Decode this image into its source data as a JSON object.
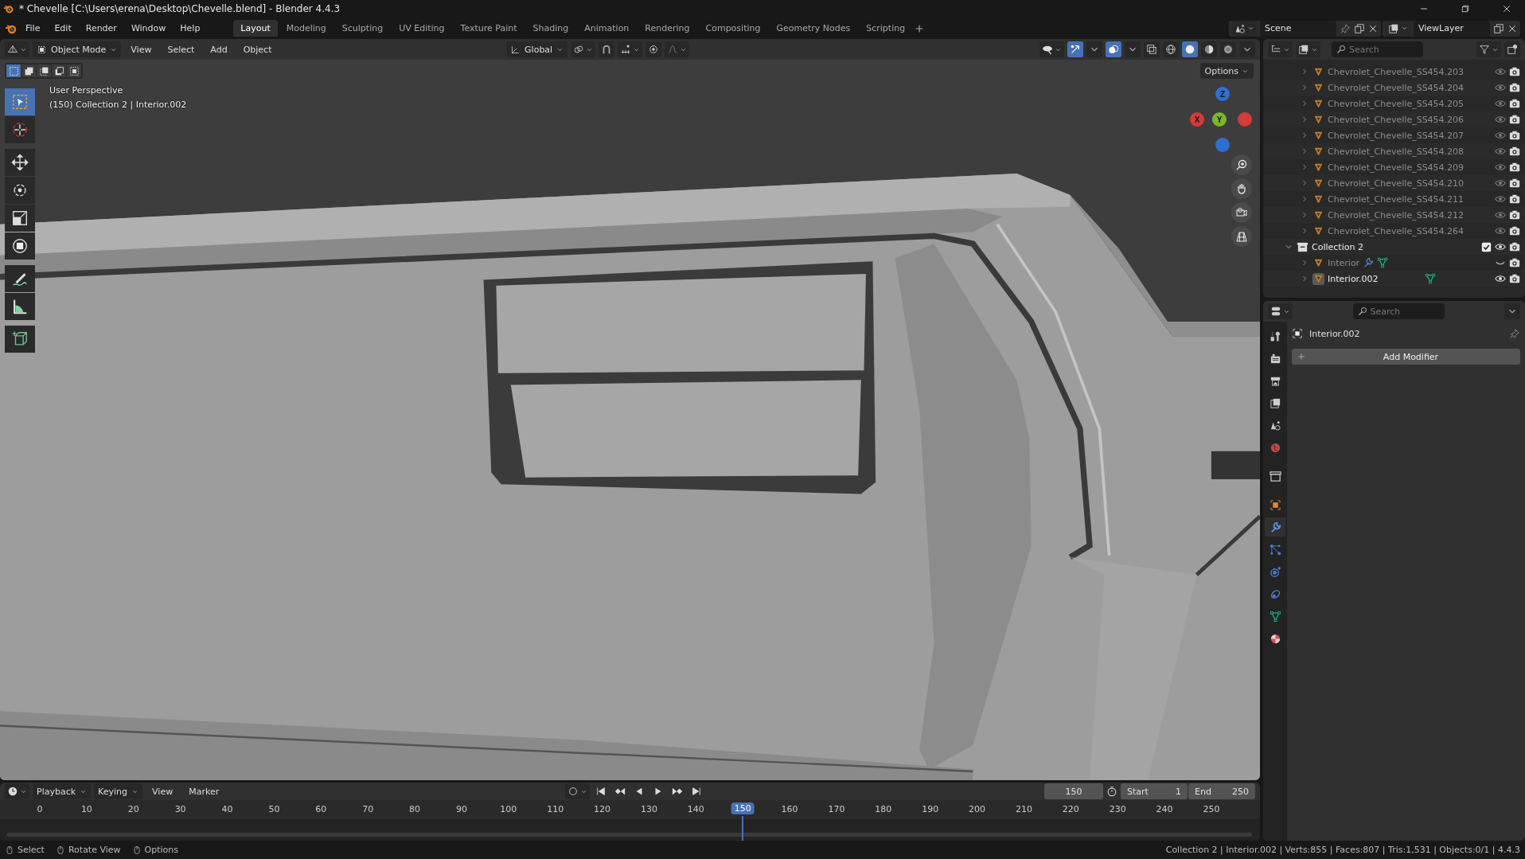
{
  "window": {
    "title": "* Chevelle [C:\\Users\\erena\\Desktop\\Chevelle.blend] - Blender 4.4.3"
  },
  "menu": [
    "File",
    "Edit",
    "Render",
    "Window",
    "Help"
  ],
  "workspaces": [
    {
      "label": "Layout",
      "selected": true
    },
    {
      "label": "Modeling",
      "selected": false
    },
    {
      "label": "Sculpting",
      "selected": false
    },
    {
      "label": "UV Editing",
      "selected": false
    },
    {
      "label": "Texture Paint",
      "selected": false
    },
    {
      "label": "Shading",
      "selected": false
    },
    {
      "label": "Animation",
      "selected": false
    },
    {
      "label": "Rendering",
      "selected": false
    },
    {
      "label": "Compositing",
      "selected": false
    },
    {
      "label": "Geometry Nodes",
      "selected": false
    },
    {
      "label": "Scripting",
      "selected": false
    }
  ],
  "scene": {
    "name": "Scene"
  },
  "view_layer": {
    "name": "ViewLayer"
  },
  "viewport_header": {
    "mode": "Object Mode",
    "menus": [
      "View",
      "Select",
      "Add",
      "Object"
    ],
    "orientation": "Global",
    "shading_modes": [
      {
        "kind": "wireframe",
        "selected": false
      },
      {
        "kind": "solid",
        "selected": true
      },
      {
        "kind": "material",
        "selected": false
      },
      {
        "kind": "rendered",
        "selected": false
      }
    ],
    "select_modes": [
      {
        "selected": true
      },
      {
        "selected": false
      },
      {
        "selected": false
      },
      {
        "selected": false
      },
      {
        "selected": false
      }
    ],
    "options": "Options"
  },
  "tools": [
    {
      "kind": "select",
      "selected": true
    },
    {
      "kind": "cursor",
      "selected": false
    },
    {
      "kind": "move",
      "selected": false
    },
    {
      "kind": "rotate",
      "selected": false
    },
    {
      "kind": "scale",
      "selected": false
    },
    {
      "kind": "transform",
      "selected": false
    },
    {
      "kind": "annotate",
      "selected": false
    },
    {
      "kind": "measure",
      "selected": false
    },
    {
      "kind": "add",
      "selected": false
    }
  ],
  "viewport": {
    "view_name": "User Perspective",
    "info": "(150) Collection 2 | Interior.002",
    "gizmo": [
      {
        "label": "Z",
        "kind": "z"
      },
      {
        "label": "Y",
        "kind": "y"
      },
      {
        "label": "X",
        "kind": "x"
      }
    ]
  },
  "outliner": {
    "search": {
      "placeholder": "Search"
    },
    "clipped_collection_children": [
      {
        "name": "Chevrolet_Chevelle_SS454.203",
        "expanded": false,
        "visible": true,
        "selected": false
      },
      {
        "name": "Chevrolet_Chevelle_SS454.204",
        "expanded": false,
        "visible": true,
        "selected": false
      },
      {
        "name": "Chevrolet_Chevelle_SS454.205",
        "expanded": false,
        "visible": true,
        "selected": false
      },
      {
        "name": "Chevrolet_Chevelle_SS454.206",
        "expanded": false,
        "visible": true,
        "selected": false
      },
      {
        "name": "Chevrolet_Chevelle_SS454.207",
        "expanded": false,
        "visible": true,
        "selected": false
      },
      {
        "name": "Chevrolet_Chevelle_SS454.208",
        "expanded": false,
        "visible": true,
        "selected": false
      },
      {
        "name": "Chevrolet_Chevelle_SS454.209",
        "expanded": false,
        "visible": true,
        "selected": false
      },
      {
        "name": "Chevrolet_Chevelle_SS454.210",
        "expanded": false,
        "visible": true,
        "selected": false
      },
      {
        "name": "Chevrolet_Chevelle_SS454.211",
        "expanded": false,
        "visible": true,
        "selected": false
      },
      {
        "name": "Chevrolet_Chevelle_SS454.212",
        "expanded": false,
        "visible": true,
        "selected": false
      },
      {
        "name": "Chevrolet_Chevelle_SS454.264",
        "expanded": false,
        "visible": true,
        "selected": false
      }
    ],
    "collections": [
      {
        "name": "Collection 2",
        "expanded": true,
        "checked": true,
        "visible": true,
        "children": [
          {
            "name": "Interior",
            "expanded": false,
            "visible": false,
            "selected": false,
            "has_modifier": true
          },
          {
            "name": "Interior.002",
            "expanded": false,
            "visible": true,
            "selected": true,
            "has_modifier": false
          }
        ]
      }
    ]
  },
  "properties": {
    "search": {
      "placeholder": "Search"
    },
    "object_name": "Interior.002",
    "add_button": "Add Modifier",
    "tabs": [
      {
        "kind": "tool",
        "selected": false
      },
      {
        "kind": "render",
        "selected": false
      },
      {
        "kind": "output",
        "selected": false
      },
      {
        "kind": "view_layer",
        "selected": false
      },
      {
        "kind": "scene",
        "selected": false
      },
      {
        "kind": "world",
        "selected": false
      },
      {
        "kind": "collection",
        "selected": false
      },
      {
        "kind": "object",
        "selected": false
      },
      {
        "kind": "modifiers",
        "selected": true
      },
      {
        "kind": "particles",
        "selected": false
      },
      {
        "kind": "physics",
        "selected": false
      },
      {
        "kind": "constraints",
        "selected": false
      },
      {
        "kind": "data",
        "selected": false
      },
      {
        "kind": "material",
        "selected": false
      }
    ]
  },
  "timeline": {
    "menus": [
      "Playback",
      "Keying",
      "View",
      "Marker"
    ],
    "current_frame": "150",
    "start_label": "Start",
    "start": "1",
    "end_label": "End",
    "end": "250",
    "ticks_before_playhead": [
      "0",
      "10",
      "20",
      "30",
      "40",
      "50",
      "60",
      "70",
      "80",
      "90",
      "100",
      "110",
      "120",
      "130",
      "140"
    ],
    "ticks_after_playhead": [
      "160",
      "170",
      "180",
      "190",
      "200",
      "210",
      "220",
      "230",
      "240",
      "250"
    ],
    "playhead": {
      "label": "150",
      "level": 0.6
    }
  },
  "status_bar": {
    "hints": [
      "Select",
      "Rotate View",
      "Options"
    ],
    "info": "Collection 2 | Interior.002 | Verts:855 | Faces:807 | Tris:1,531 | Objects:0/1 | 4.4.3"
  }
}
